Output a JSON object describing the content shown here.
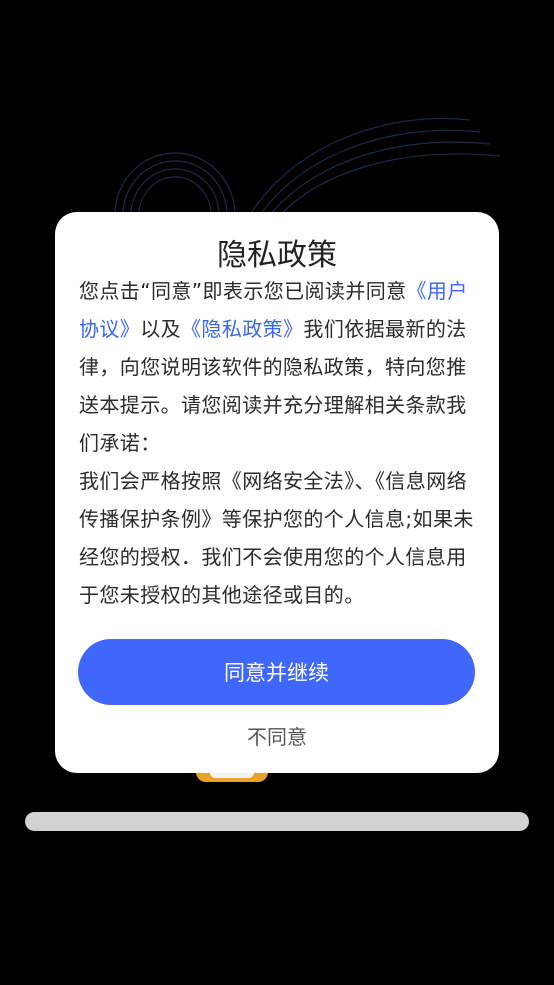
{
  "dialog": {
    "title": "隐私政策",
    "intro_before_link1": "您点击“同意”即表示您已阅读并同意",
    "link_user_agreement": "《用户协议》",
    "intro_between_links": "以及",
    "link_privacy_policy": "《隐私政策》",
    "intro_after_links": "我们依据最新的法律，向您说明该软件的隐私政策，特向您推送本提示。请您阅读并充分理解相关条款我们承诺：",
    "commitment": "我们会严格按照《网络安全法》、《信息网络传播保护条例》等保护您的个人信息;如果未经您的授权．我们不会使用您的个人信息用于您未授权的其他途径或目的。",
    "agree_button": "同意并继续",
    "disagree_button": "不同意"
  },
  "colors": {
    "background": "#000000",
    "dialog": "#ffffff",
    "primary": "#3f67fb",
    "link": "#3a66ff"
  }
}
